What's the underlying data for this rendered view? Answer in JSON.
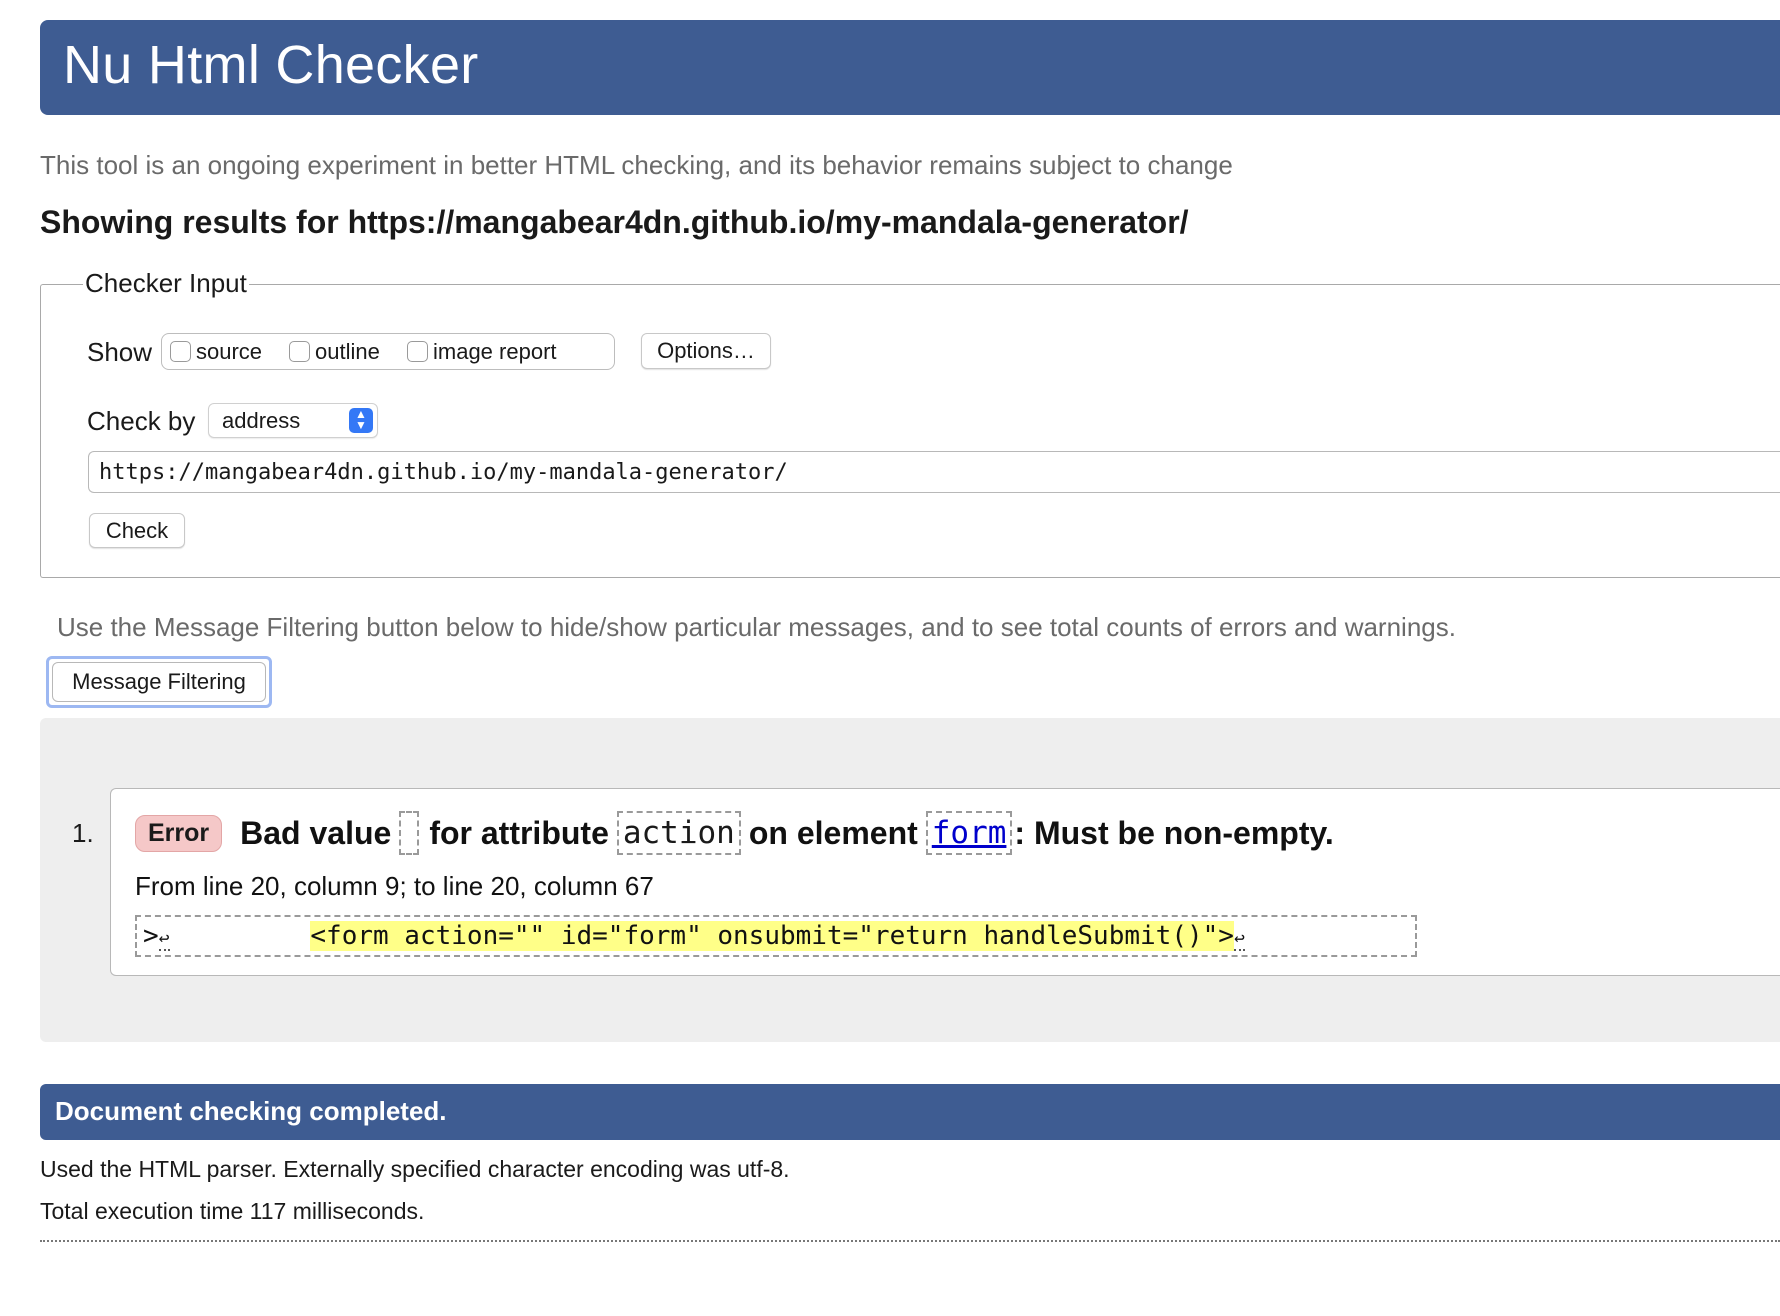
{
  "header": {
    "title": "Nu Html Checker"
  },
  "intro": "This tool is an ongoing experiment in better HTML checking, and its behavior remains subject to change",
  "results_heading": "Showing results for https://mangabear4dn.github.io/my-mandala-generator/",
  "checker_input": {
    "legend": "Checker Input",
    "show_label": "Show",
    "show_options": [
      {
        "label": "source",
        "checked": false
      },
      {
        "label": "outline",
        "checked": false
      },
      {
        "label": "image report",
        "checked": false
      }
    ],
    "options_button": "Options…",
    "check_by_label": "Check by",
    "check_by_value": "address",
    "url_value": "https://mangabear4dn.github.io/my-mandala-generator/",
    "check_button": "Check"
  },
  "filter_hint": "Use the Message Filtering button below to hide/show particular messages, and to see total counts of errors and warnings.",
  "filter_button": "Message Filtering",
  "messages": [
    {
      "number": "1.",
      "type": "Error",
      "text_1": "Bad value",
      "value": "",
      "text_2": "for attribute",
      "attribute": "action",
      "text_3": "on element",
      "element": "form",
      "text_4": ": Must be non-empty.",
      "location": "From line 20, column 9; to line 20, column 67",
      "extract_prefix": ">",
      "extract_gap": "         ",
      "extract_highlight": "<form action=\"\" id=\"form\" onsubmit=\"return handleSubmit()\">",
      "linefeed_symbol": "↩"
    }
  ],
  "status": "Document checking completed.",
  "info": [
    "Used the HTML parser. Externally specified character encoding was utf-8.",
    "Total execution time 117 milliseconds."
  ],
  "colors": {
    "header_bg": "#3e5c92",
    "error_badge": "#f5c8c8",
    "highlight": "#ffff88",
    "link": "#0000cc"
  }
}
